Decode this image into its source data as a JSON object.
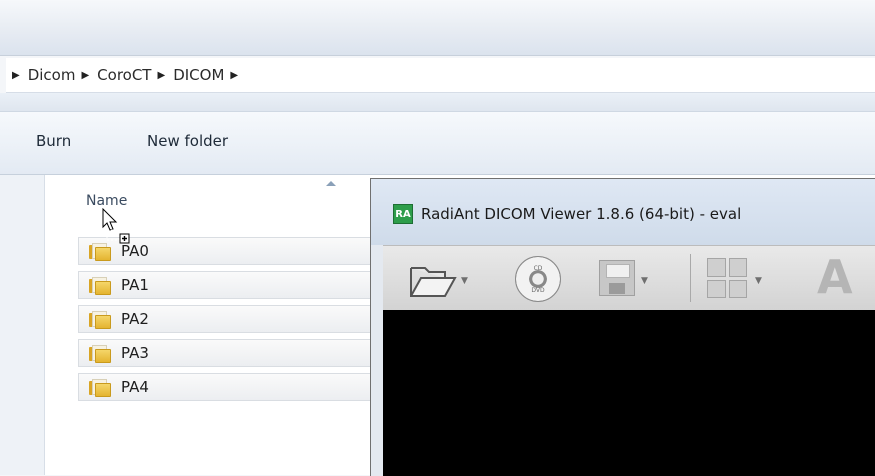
{
  "breadcrumb": {
    "items": [
      "Dicom",
      "CoroCT",
      "DICOM"
    ]
  },
  "commandbar": {
    "burn_label": "Burn",
    "new_folder_label": "New folder"
  },
  "filelist": {
    "column_name": "Name",
    "items": [
      {
        "label": "PA0"
      },
      {
        "label": "PA1"
      },
      {
        "label": "PA2"
      },
      {
        "label": "PA3"
      },
      {
        "label": "PA4"
      }
    ]
  },
  "viewer": {
    "logo_text": "RA",
    "title": "RadiAnt DICOM Viewer 1.8.6 (64-bit) - eval",
    "cd_top": "CD",
    "cd_bottom": "DVD"
  },
  "icons": [
    "folder-icon",
    "open-folder-icon",
    "cd-dvd-icon",
    "save-icon",
    "layout-grid-icon",
    "annotation-icon",
    "drag-copy-cursor-icon"
  ],
  "colors": {
    "viewer_background": "#000000",
    "folder": "#e4b431",
    "logo": "#2d9d4a"
  }
}
